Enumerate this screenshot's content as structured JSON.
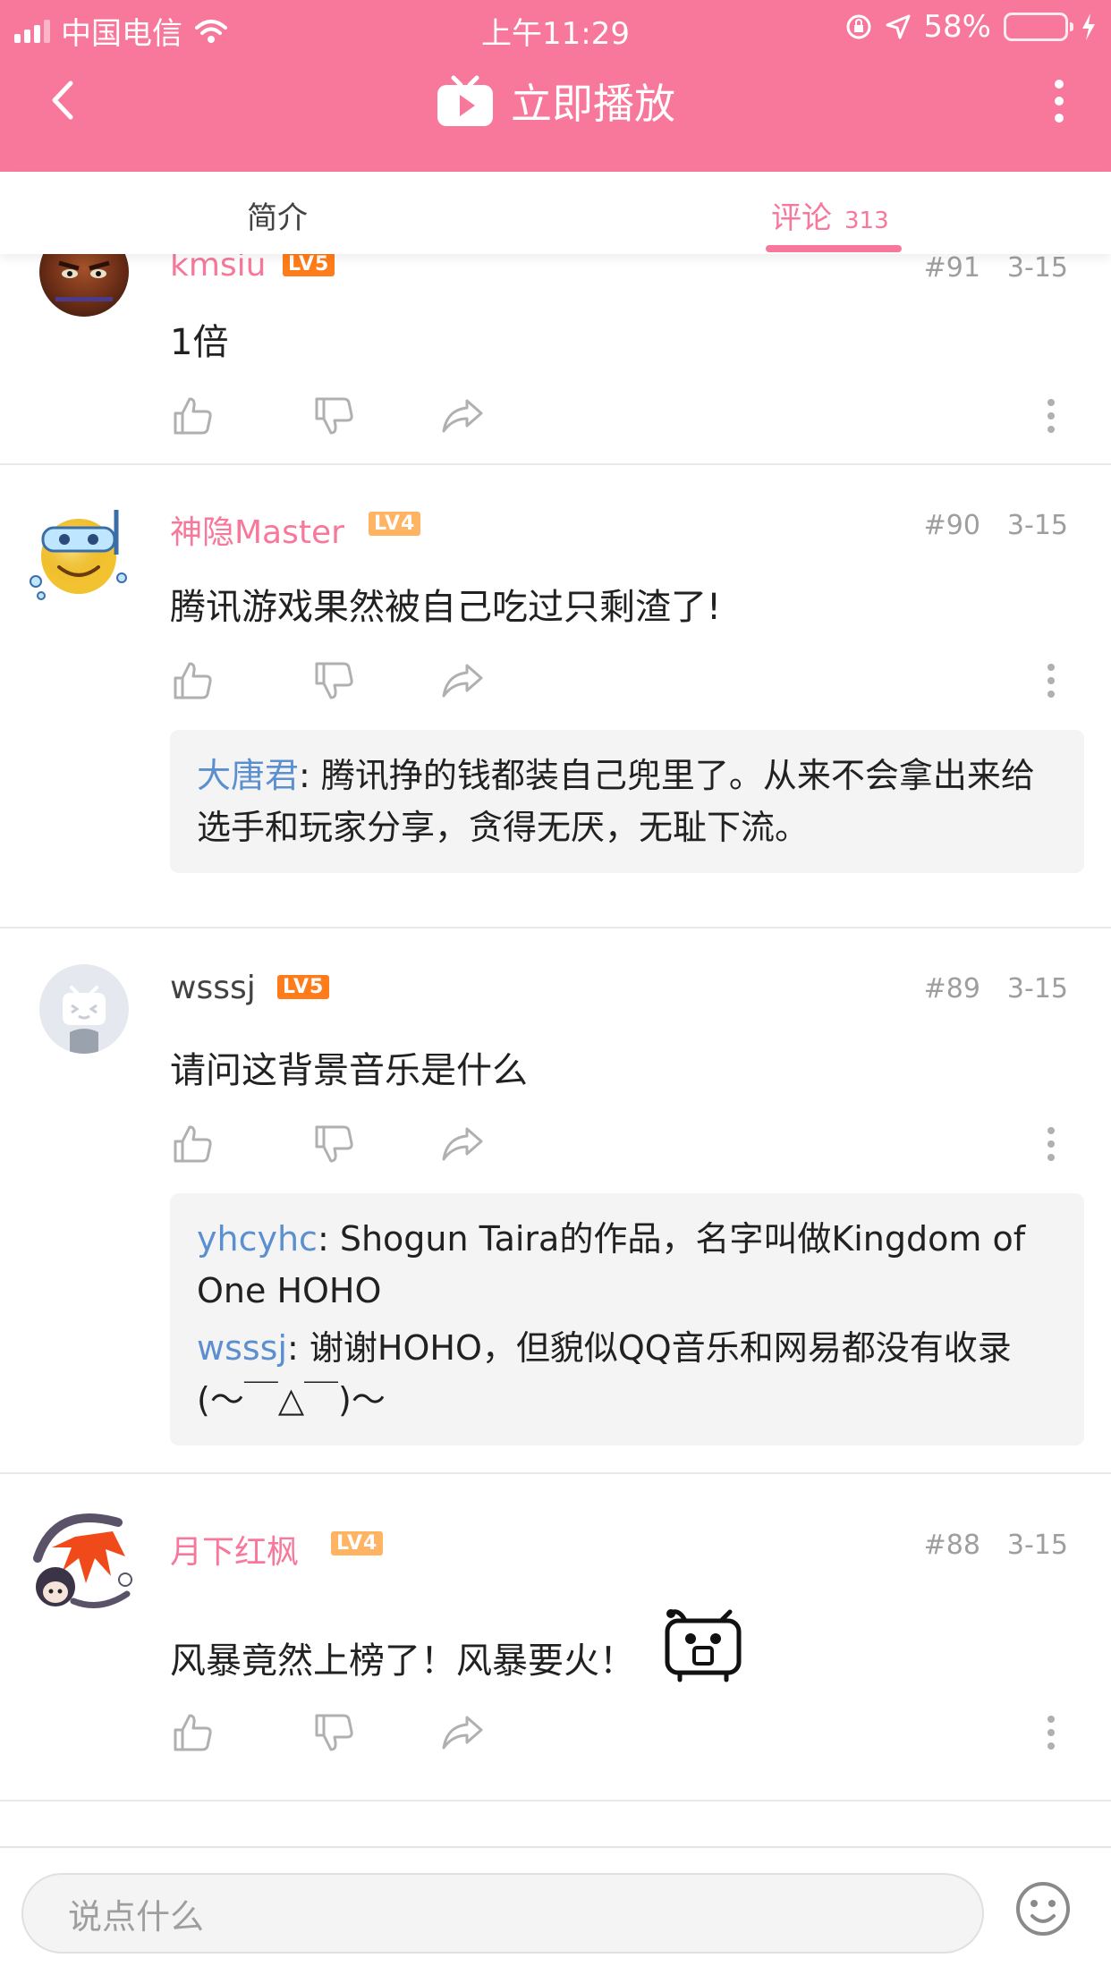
{
  "status_bar": {
    "carrier": "中国电信",
    "time": "上午11:29",
    "battery": "58%",
    "battery_level": 0.58
  },
  "nav": {
    "title": "立即播放",
    "icons": {
      "back": "chevron-left-icon",
      "play": "tv-play-icon",
      "more": "more-vertical-icon"
    }
  },
  "tabs": {
    "intro": "简介",
    "comments": "评论",
    "comments_count": "313"
  },
  "comments": [
    {
      "user": "kmsiu",
      "level": "LV5",
      "floor": "#91",
      "date": "3-15",
      "text": "1倍",
      "replies": []
    },
    {
      "user": "神隐Master",
      "level": "LV4",
      "floor": "#90",
      "date": "3-15",
      "text": "腾讯游戏果然被自己吃过只剩渣了!",
      "replies": [
        {
          "user": "大唐君",
          "text": ": 腾讯挣的钱都装自己兜里了。从来不会拿出来给选手和玩家分享，贪得无厌，无耻下流。"
        }
      ]
    },
    {
      "user": "wsssj",
      "level": "LV5",
      "floor": "#89",
      "date": "3-15",
      "text": "请问这背景音乐是什么",
      "replies": [
        {
          "user": "yhcyhc",
          "text": ": Shogun Taira的作品，名字叫做Kingdom of One HOHO"
        },
        {
          "user": "wsssj",
          "text": ": 谢谢HOHO，但貌似QQ音乐和网易都没有收录(～￣△￣)～"
        }
      ]
    },
    {
      "user": "月下红枫",
      "level": "LV4",
      "floor": "#88",
      "date": "3-15",
      "text": "风暴竟然上榜了！风暴要火！",
      "replies": []
    }
  ],
  "input": {
    "placeholder": "说点什么"
  },
  "colors": {
    "accent": "#f7789b",
    "reply_user": "#5b8fd0",
    "lv5": "#ff7c1a",
    "lv4": "#ffb463"
  }
}
